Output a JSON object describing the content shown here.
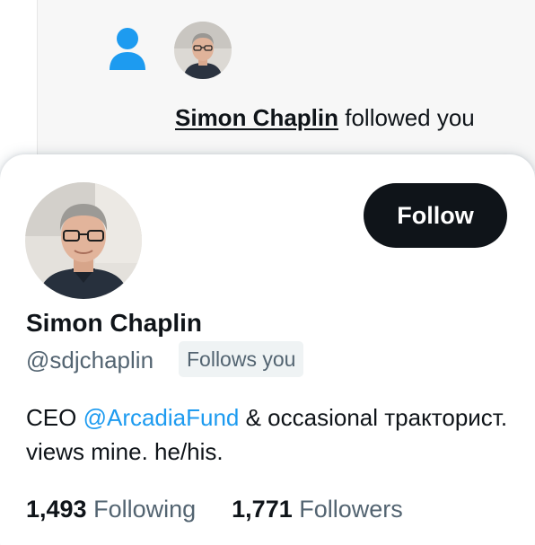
{
  "notification": {
    "user_name": "Simon Chaplin",
    "action_text": "followed you",
    "icon": "person-icon",
    "accent": "#1d9bf0"
  },
  "hover_card": {
    "display_name": "Simon Chaplin",
    "handle": "@sdjchaplin",
    "follows_you_badge": "Follows you",
    "follow_button_label": "Follow",
    "bio": {
      "prefix": "CEO ",
      "mention": "@ArcadiaFund",
      "suffix": " & occasional тракторист. views mine. he/his."
    },
    "stats": {
      "following_count": "1,493",
      "following_label": "Following",
      "followers_count": "1,771",
      "followers_label": "Followers"
    },
    "colors": {
      "text": "#0f1419",
      "secondary": "#536471",
      "link": "#1d9bf0",
      "button_bg": "#0f1419"
    }
  }
}
